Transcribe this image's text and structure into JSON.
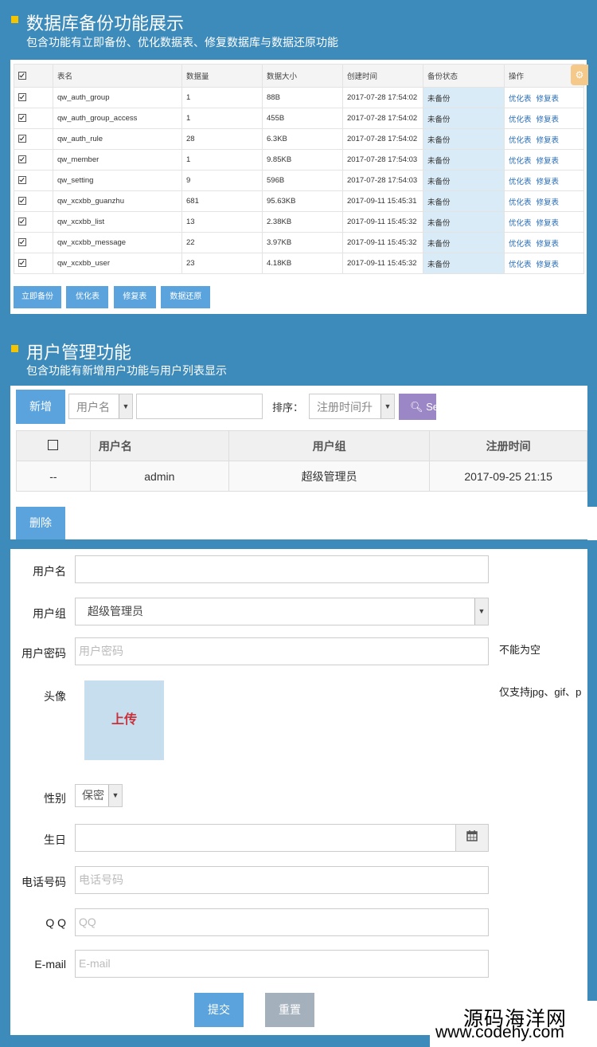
{
  "section1": {
    "title": "数据库备份功能展示",
    "subtitle": "包含功能有立即备份、优化数据表、修复数据库与数据还原功能"
  },
  "backup_table": {
    "headers": [
      "表名",
      "数据量",
      "数据大小",
      "创建时间",
      "备份状态",
      "操作"
    ],
    "rows": [
      {
        "name": "qw_auth_group",
        "count": "1",
        "size": "88B",
        "created": "2017-07-28 17:54:02",
        "status": "未备份"
      },
      {
        "name": "qw_auth_group_access",
        "count": "1",
        "size": "455B",
        "created": "2017-07-28 17:54:02",
        "status": "未备份"
      },
      {
        "name": "qw_auth_rule",
        "count": "28",
        "size": "6.3KB",
        "created": "2017-07-28 17:54:02",
        "status": "未备份"
      },
      {
        "name": "qw_member",
        "count": "1",
        "size": "9.85KB",
        "created": "2017-07-28 17:54:03",
        "status": "未备份"
      },
      {
        "name": "qw_setting",
        "count": "9",
        "size": "596B",
        "created": "2017-07-28 17:54:03",
        "status": "未备份"
      },
      {
        "name": "qw_xcxbb_guanzhu",
        "count": "681",
        "size": "95.63KB",
        "created": "2017-09-11 15:45:31",
        "status": "未备份"
      },
      {
        "name": "qw_xcxbb_list",
        "count": "13",
        "size": "2.38KB",
        "created": "2017-09-11 15:45:32",
        "status": "未备份"
      },
      {
        "name": "qw_xcxbb_message",
        "count": "22",
        "size": "3.97KB",
        "created": "2017-09-11 15:45:32",
        "status": "未备份"
      },
      {
        "name": "qw_xcxbb_user",
        "count": "23",
        "size": "4.18KB",
        "created": "2017-09-11 15:45:32",
        "status": "未备份"
      }
    ],
    "action_optimize": "优化表",
    "action_repair": "修复表"
  },
  "backup_buttons": {
    "backup": "立即备份",
    "optimize": "优化表",
    "repair": "修复表",
    "restore": "数据还原"
  },
  "section2": {
    "title": "用户管理功能",
    "subtitle": "包含功能有新增用户功能与用户列表显示"
  },
  "user_toolbar": {
    "add": "新增",
    "field_select": "用户名",
    "sort_label": "排序：",
    "sort_select": "注册时间升",
    "search": "Se"
  },
  "user_table": {
    "headers": [
      "用户名",
      "用户组",
      "注册时间"
    ],
    "rows": [
      {
        "id": "--",
        "username": "admin",
        "group": "超级管理员",
        "registered": "2017-09-25 21:15"
      }
    ]
  },
  "user_delete": "删除",
  "form": {
    "username_label": "用户名",
    "group_label": "用户组",
    "group_value": "超级管理员",
    "password_label": "用户密码",
    "password_placeholder": "用户密码",
    "password_hint": "不能为空",
    "avatar_label": "头像",
    "upload_label": "上传",
    "avatar_hint": "仅支持jpg、gif、p",
    "gender_label": "性别",
    "gender_value": "保密",
    "birthday_label": "生日",
    "phone_label": "电话号码",
    "phone_placeholder": "电话号码",
    "qq_label": "Q Q",
    "qq_placeholder": "QQ",
    "email_label": "E-mail",
    "email_placeholder": "E-mail",
    "submit": "提交",
    "reset": "重置"
  },
  "watermark": {
    "line1": "源码海洋网",
    "line2": "www.codehy.com"
  },
  "colors": {
    "background": "#3d8bbb",
    "button_blue": "#5aa3dc",
    "search_purple": "#9b86c6",
    "status_cell": "#d9ebf6",
    "bullet": "#f5c400"
  }
}
